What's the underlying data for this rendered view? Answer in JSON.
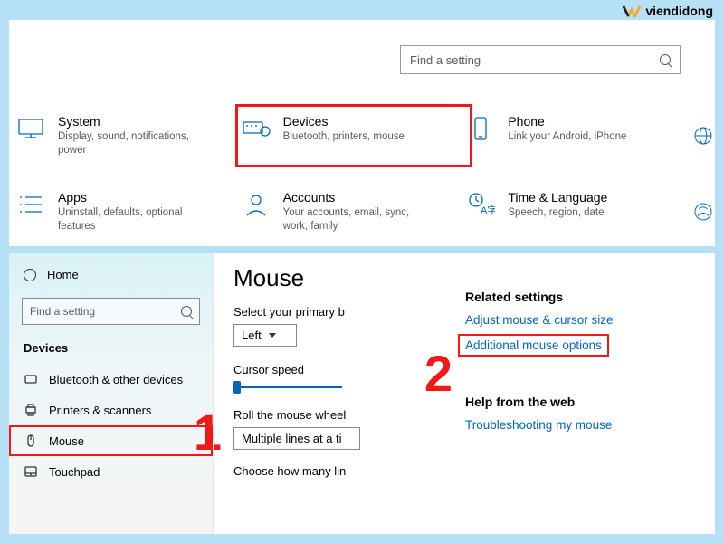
{
  "watermark": "viendidong",
  "top": {
    "search_placeholder": "Find a setting",
    "categories": [
      {
        "key": "system",
        "title": "System",
        "sub": "Display, sound, notifications, power"
      },
      {
        "key": "devices",
        "title": "Devices",
        "sub": "Bluetooth, printers, mouse",
        "highlighted": true
      },
      {
        "key": "phone",
        "title": "Phone",
        "sub": "Link your Android, iPhone"
      },
      {
        "key": "apps",
        "title": "Apps",
        "sub": "Uninstall, defaults, optional features"
      },
      {
        "key": "accounts",
        "title": "Accounts",
        "sub": "Your accounts, email, sync, work, family"
      },
      {
        "key": "time",
        "title": "Time & Language",
        "sub": "Speech, region, date"
      }
    ]
  },
  "sidebar": {
    "home": "Home",
    "search_placeholder": "Find a setting",
    "heading": "Devices",
    "items": [
      {
        "key": "bt",
        "label": "Bluetooth & other devices"
      },
      {
        "key": "print",
        "label": "Printers & scanners"
      },
      {
        "key": "mouse",
        "label": "Mouse",
        "highlighted": true
      },
      {
        "key": "touch",
        "label": "Touchpad"
      }
    ]
  },
  "step1": "1",
  "step2": "2",
  "mid": {
    "title": "Mouse",
    "primary_label": "Select your primary b",
    "primary_value": "Left",
    "cursor_label": "Cursor speed",
    "wheel_label": "Roll the mouse wheel",
    "wheel_value": "Multiple lines at a ti",
    "lines_label": "Choose how many lin"
  },
  "right": {
    "related_heading": "Related settings",
    "adjust_link": "Adjust mouse & cursor size",
    "additional_link": "Additional mouse options",
    "help_heading": "Help from the web",
    "troubleshoot_link": "Troubleshooting my mouse"
  }
}
